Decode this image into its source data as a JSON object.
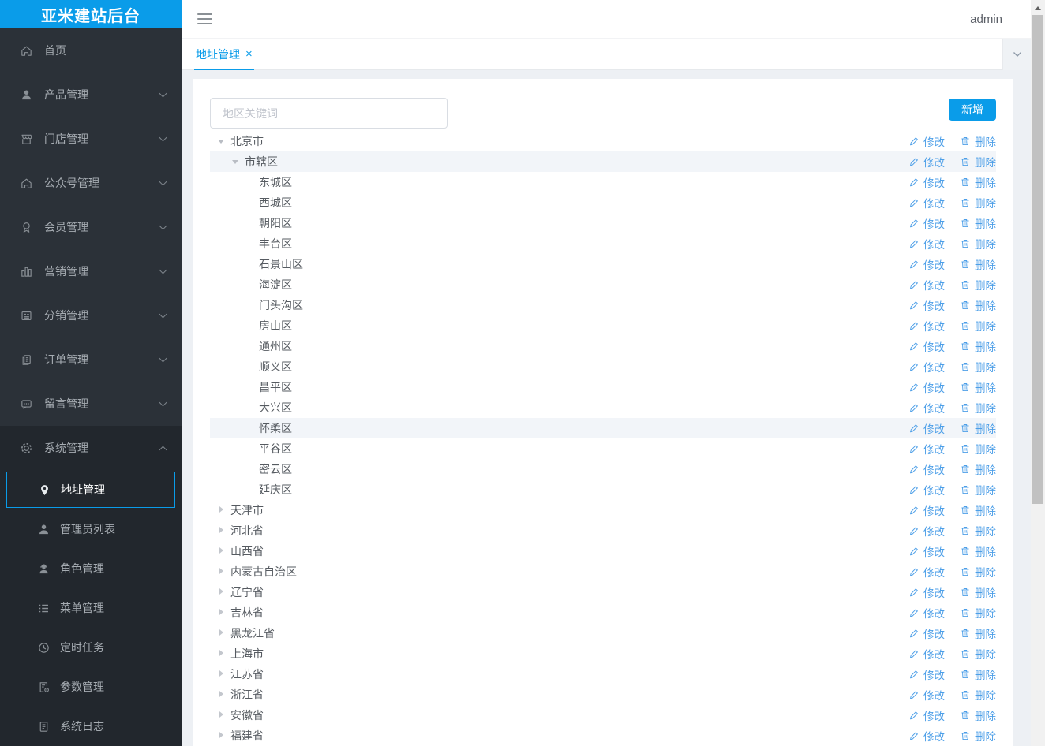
{
  "app": {
    "logo_title": "亚米建站后台"
  },
  "topbar": {
    "username": "admin"
  },
  "tabbar": {
    "tabs": [
      {
        "label": "地址管理",
        "close_glyph": "×",
        "active": true
      }
    ]
  },
  "toolbar": {
    "search_placeholder": "地区关键词",
    "add_button": "新增"
  },
  "colors": {
    "primary": "#0a9ce9",
    "action_link": "#4d9fe8",
    "sidebar_bg": "#2b3138",
    "sidebar_section_bg": "#22272d",
    "row_highlight": "#f2f5f9"
  },
  "sidebar": {
    "items": [
      {
        "label": "首页",
        "icon": "home-icon",
        "has_children": false
      },
      {
        "label": "产品管理",
        "icon": "user-icon",
        "has_children": true
      },
      {
        "label": "门店管理",
        "icon": "store-icon",
        "has_children": true
      },
      {
        "label": "公众号管理",
        "icon": "official-account-icon",
        "has_children": true
      },
      {
        "label": "会员管理",
        "icon": "member-badge-icon",
        "has_children": true
      },
      {
        "label": "营销管理",
        "icon": "bar-chart-icon",
        "has_children": true
      },
      {
        "label": "分销管理",
        "icon": "distribution-icon",
        "has_children": true
      },
      {
        "label": "订单管理",
        "icon": "order-icon",
        "has_children": true
      },
      {
        "label": "留言管理",
        "icon": "message-icon",
        "has_children": true
      }
    ],
    "system": {
      "label": "系统管理",
      "icon": "gear-icon",
      "expanded": true,
      "subitems": [
        {
          "label": "地址管理",
          "icon": "location-pin-icon",
          "active": true
        },
        {
          "label": "管理员列表",
          "icon": "admin-list-icon",
          "active": false
        },
        {
          "label": "角色管理",
          "icon": "role-icon",
          "active": false
        },
        {
          "label": "菜单管理",
          "icon": "menu-list-icon",
          "active": false
        },
        {
          "label": "定时任务",
          "icon": "clock-icon",
          "active": false
        },
        {
          "label": "参数管理",
          "icon": "params-icon",
          "active": false
        },
        {
          "label": "系统日志",
          "icon": "log-icon",
          "active": false
        }
      ]
    }
  },
  "tree": {
    "edit_label": "修改",
    "delete_label": "删除",
    "rows": [
      {
        "label": "北京市",
        "level": 0,
        "state": "expanded",
        "highlight": false
      },
      {
        "label": "市辖区",
        "level": 1,
        "state": "expanded",
        "highlight": true
      },
      {
        "label": "东城区",
        "level": 2,
        "state": "leaf",
        "highlight": false
      },
      {
        "label": "西城区",
        "level": 2,
        "state": "leaf",
        "highlight": false
      },
      {
        "label": "朝阳区",
        "level": 2,
        "state": "leaf",
        "highlight": false
      },
      {
        "label": "丰台区",
        "level": 2,
        "state": "leaf",
        "highlight": false
      },
      {
        "label": "石景山区",
        "level": 2,
        "state": "leaf",
        "highlight": false
      },
      {
        "label": "海淀区",
        "level": 2,
        "state": "leaf",
        "highlight": false
      },
      {
        "label": "门头沟区",
        "level": 2,
        "state": "leaf",
        "highlight": false
      },
      {
        "label": "房山区",
        "level": 2,
        "state": "leaf",
        "highlight": false
      },
      {
        "label": "通州区",
        "level": 2,
        "state": "leaf",
        "highlight": false
      },
      {
        "label": "顺义区",
        "level": 2,
        "state": "leaf",
        "highlight": false
      },
      {
        "label": "昌平区",
        "level": 2,
        "state": "leaf",
        "highlight": false
      },
      {
        "label": "大兴区",
        "level": 2,
        "state": "leaf",
        "highlight": false
      },
      {
        "label": "怀柔区",
        "level": 2,
        "state": "leaf",
        "highlight": true
      },
      {
        "label": "平谷区",
        "level": 2,
        "state": "leaf",
        "highlight": false
      },
      {
        "label": "密云区",
        "level": 2,
        "state": "leaf",
        "highlight": false
      },
      {
        "label": "延庆区",
        "level": 2,
        "state": "leaf",
        "highlight": false
      },
      {
        "label": "天津市",
        "level": 0,
        "state": "collapsed",
        "highlight": false
      },
      {
        "label": "河北省",
        "level": 0,
        "state": "collapsed",
        "highlight": false
      },
      {
        "label": "山西省",
        "level": 0,
        "state": "collapsed",
        "highlight": false
      },
      {
        "label": "内蒙古自治区",
        "level": 0,
        "state": "collapsed",
        "highlight": false
      },
      {
        "label": "辽宁省",
        "level": 0,
        "state": "collapsed",
        "highlight": false
      },
      {
        "label": "吉林省",
        "level": 0,
        "state": "collapsed",
        "highlight": false
      },
      {
        "label": "黑龙江省",
        "level": 0,
        "state": "collapsed",
        "highlight": false
      },
      {
        "label": "上海市",
        "level": 0,
        "state": "collapsed",
        "highlight": false
      },
      {
        "label": "江苏省",
        "level": 0,
        "state": "collapsed",
        "highlight": false
      },
      {
        "label": "浙江省",
        "level": 0,
        "state": "collapsed",
        "highlight": false
      },
      {
        "label": "安徽省",
        "level": 0,
        "state": "collapsed",
        "highlight": false
      },
      {
        "label": "福建省",
        "level": 0,
        "state": "collapsed",
        "highlight": false
      }
    ]
  }
}
